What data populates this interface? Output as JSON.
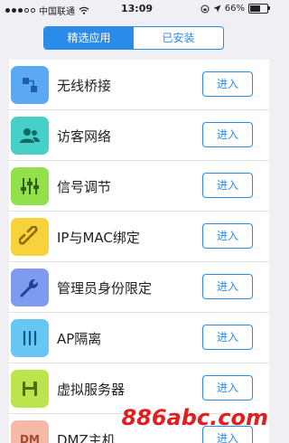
{
  "status_bar": {
    "carrier": "中国联通",
    "time": "13:09",
    "battery_percent": "66%",
    "battery_level": 0.66
  },
  "tabs": [
    {
      "label": "精选应用",
      "active": true
    },
    {
      "label": "已安装",
      "active": false
    }
  ],
  "apps": [
    {
      "name": "无线桥接",
      "button": "进入",
      "icon": "wireless-bridge-icon",
      "color": "#5aa9f2"
    },
    {
      "name": "访客网络",
      "button": "进入",
      "icon": "guest-network-icon",
      "color": "#46d0c8"
    },
    {
      "name": "信号调节",
      "button": "进入",
      "icon": "signal-adjust-icon",
      "color": "#93e04a"
    },
    {
      "name": "IP与MAC绑定",
      "button": "进入",
      "icon": "ip-mac-bind-icon",
      "color": "#f7d23a"
    },
    {
      "name": "管理员身份限定",
      "button": "进入",
      "icon": "admin-restrict-icon",
      "color": "#7e9bf0"
    },
    {
      "name": "AP隔离",
      "button": "进入",
      "icon": "ap-isolation-icon",
      "color": "#67c7f2"
    },
    {
      "name": "虚拟服务器",
      "button": "进入",
      "icon": "virtual-server-icon",
      "color": "#bce54d"
    },
    {
      "name": "DMZ主机",
      "button": "进入",
      "icon": "dmz-host-icon",
      "icon_text": "DM",
      "color": "#f6b9a8"
    }
  ],
  "watermark": "886abc.com",
  "colors": {
    "accent": "#2a8be8",
    "watermark": "#e02020"
  }
}
